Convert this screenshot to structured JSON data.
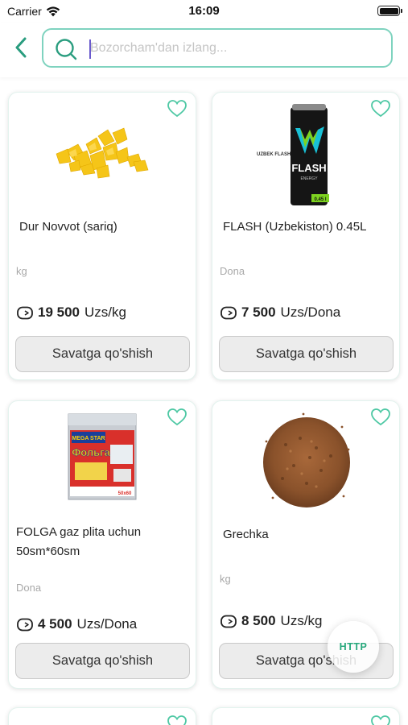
{
  "status_bar": {
    "carrier": "Carrier",
    "time": "16:09"
  },
  "search": {
    "placeholder": "Bozorcham'dan izlang..."
  },
  "colors": {
    "accent": "#2a9d7f",
    "border": "#7fd3bf",
    "heart": "#4ec8a4"
  },
  "products": [
    {
      "name": "Dur Novvot (sariq)",
      "unit": "kg",
      "price": "19 500",
      "currency": "Uzs/kg",
      "button": "Savatga qo'shish",
      "image": "yellow-candy-image",
      "favorite": false
    },
    {
      "name": "FLASH (Uzbekiston) 0.45L",
      "unit": "Dona",
      "price": "7 500",
      "currency": "Uzs/Dona",
      "button": "Savatga qo'shish",
      "image": "energy-drink-can-image",
      "favorite": false,
      "can_brand": "FLASH",
      "can_small_text": "UZBEK FLASH",
      "can_sub": "ENERGY",
      "can_volume": "0.45 l"
    },
    {
      "name": "FOLGA gaz plita uchun 50sm*60sm",
      "unit": "Dona",
      "price": "4 500",
      "currency": "Uzs/Dona",
      "button": "Savatga qo'shish",
      "image": "foil-package-image",
      "favorite": false,
      "pack_brand": "MEGA STAR",
      "pack_title": "Фольга",
      "pack_size": "50x60"
    },
    {
      "name": "Grechka",
      "unit": "kg",
      "price": "8 500",
      "currency": "Uzs/kg",
      "button": "Savatga qo'shish",
      "image": "buckwheat-image",
      "favorite": false
    }
  ],
  "fab": {
    "label": "HTTP"
  }
}
